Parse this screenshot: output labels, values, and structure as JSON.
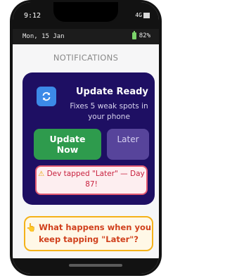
{
  "status": {
    "time": "9:12",
    "network": "4G",
    "date": "Mon, 15 Jan",
    "battery": "82%"
  },
  "heading": "NOTIFICATIONS",
  "notification": {
    "app_icon": "refresh-icon",
    "title": "Update Ready",
    "description": "Fixes 5 weak spots in your phone",
    "update_button": "Update Now",
    "later_button": "Later",
    "alert_icon": "warning-icon",
    "alert_text": "Dev tapped \"Later\" — Day 87!"
  },
  "callout": {
    "icon": "pointing-hand-icon",
    "text": "What happens when you keep tapping \"Later\"?"
  },
  "colors": {
    "card_bg": "#1e0f63",
    "update_green": "#2e9b4d",
    "later_purple": "#57449b",
    "alert_red": "#e35a72",
    "callout_orange": "#f4b21a"
  }
}
